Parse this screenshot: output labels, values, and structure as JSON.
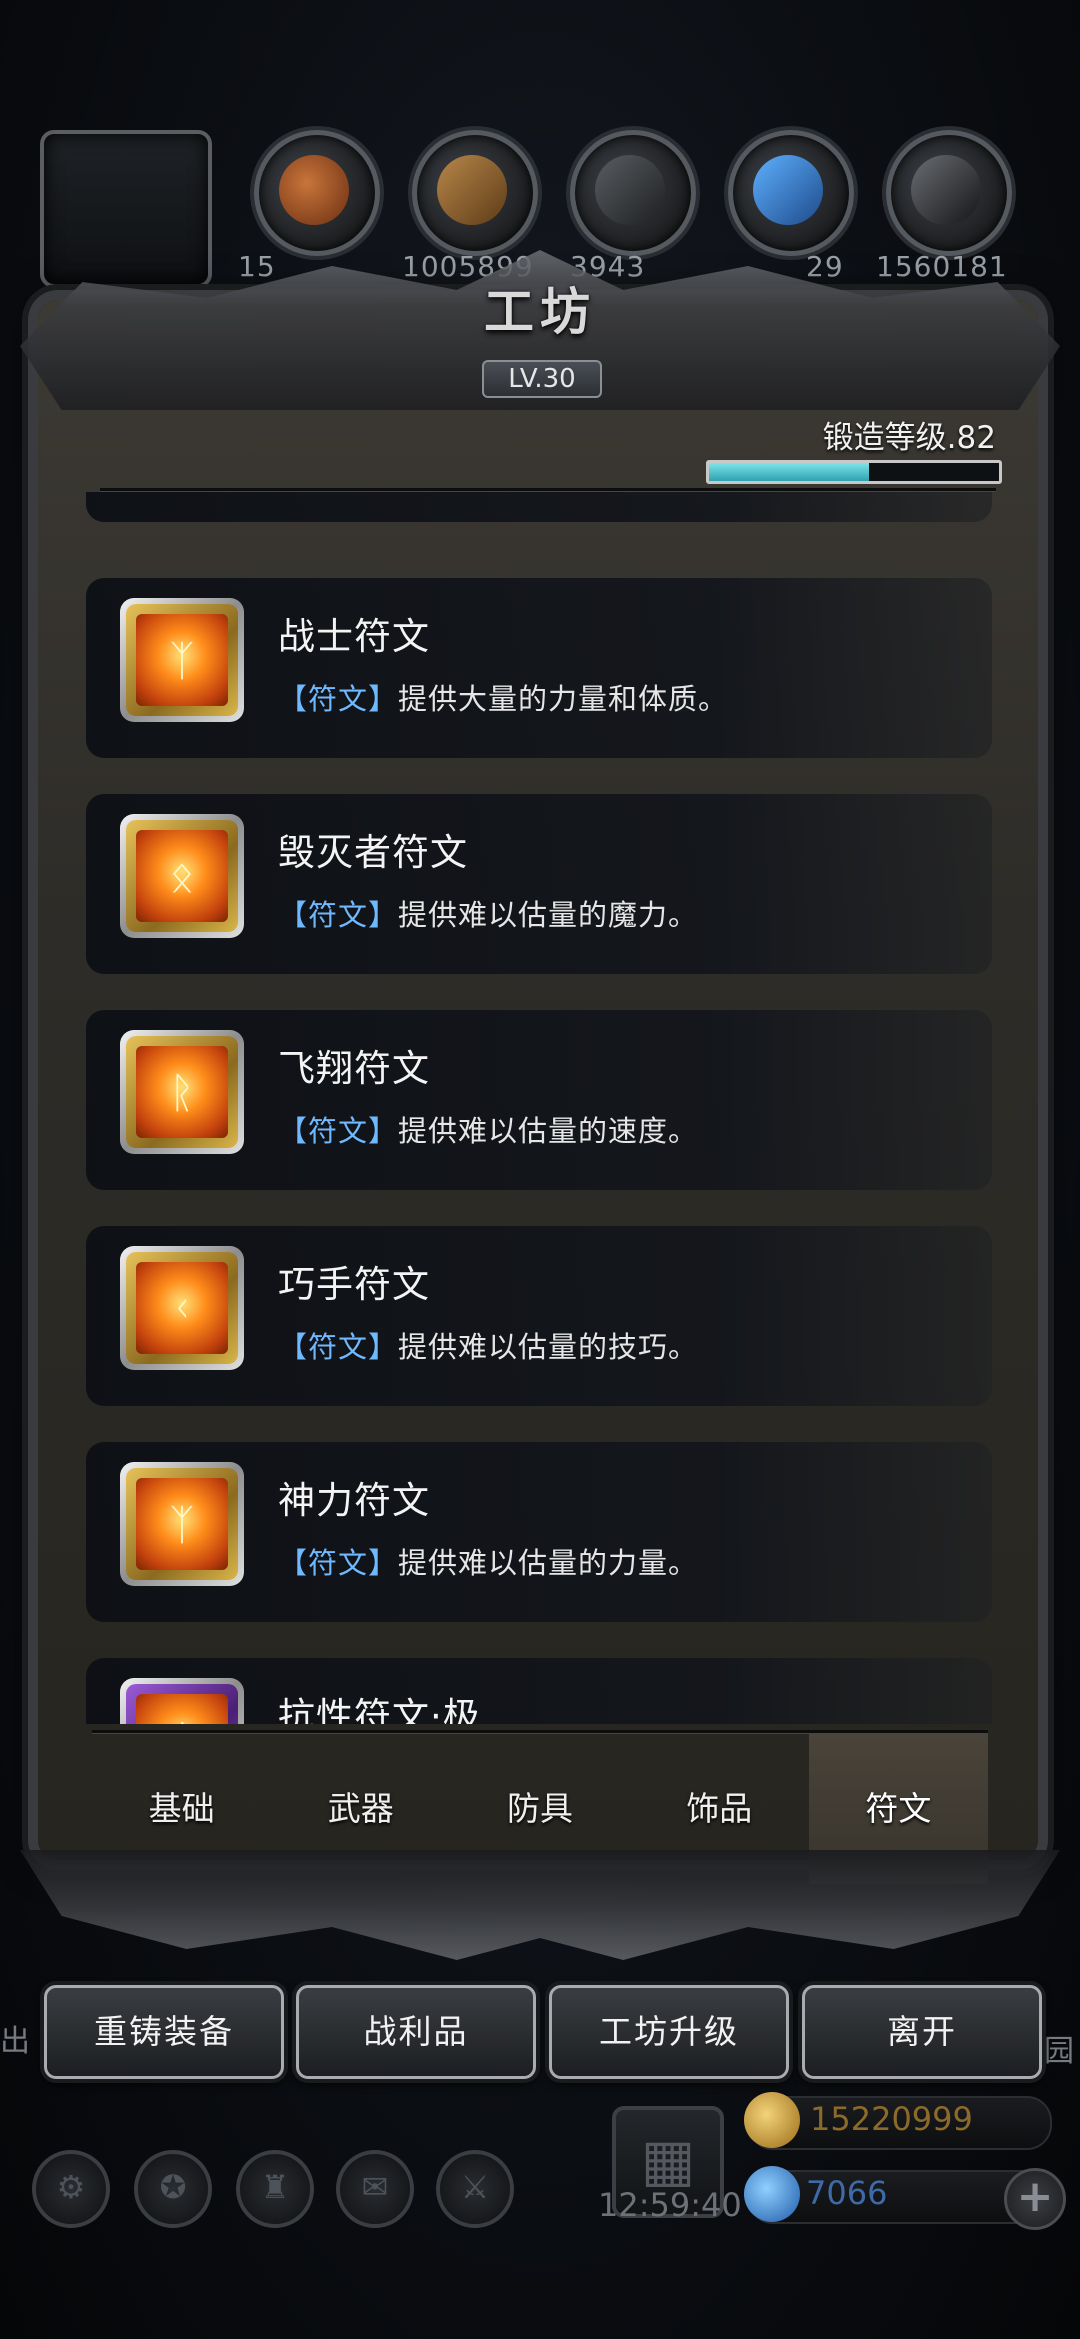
{
  "resources": {
    "values": [
      "15",
      "1005899",
      "3943",
      "29",
      "1560181"
    ]
  },
  "workshop": {
    "title": "工坊",
    "level": "LV.30",
    "forge_level_label": "锻造等级.82",
    "forge_progress": 0.55
  },
  "runes": [
    {
      "name": "战士符文",
      "tag": "【符文】",
      "desc": "提供大量的力量和体质。",
      "symbol": "ᛉ",
      "color": "gold"
    },
    {
      "name": "毁灭者符文",
      "tag": "【符文】",
      "desc": "提供难以估量的魔力。",
      "symbol": "ᛟ",
      "color": "gold"
    },
    {
      "name": "飞翔符文",
      "tag": "【符文】",
      "desc": "提供难以估量的速度。",
      "symbol": "ᚱ",
      "color": "gold"
    },
    {
      "name": "巧手符文",
      "tag": "【符文】",
      "desc": "提供难以估量的技巧。",
      "symbol": "ᚲ",
      "color": "gold"
    },
    {
      "name": "神力符文",
      "tag": "【符文】",
      "desc": "提供难以估量的力量。",
      "symbol": "ᛉ",
      "color": "gold"
    },
    {
      "name": "抗性符文·极",
      "tag": "",
      "desc": "",
      "symbol": "ᛇ",
      "color": "purple"
    }
  ],
  "tabs": [
    "基础",
    "武器",
    "防具",
    "饰品",
    "符文"
  ],
  "active_tab": 4,
  "buttons": [
    "重铸装备",
    "战利品",
    "工坊升级",
    "离开"
  ],
  "hud": {
    "clock": "12:59:40",
    "gold": "15220999",
    "gems": "7066",
    "left_hint": "出",
    "right_hint": "园"
  }
}
